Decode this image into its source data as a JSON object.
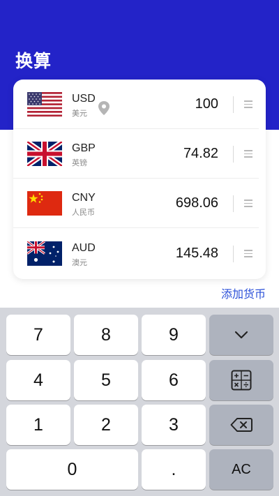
{
  "header": {
    "title": "换算"
  },
  "currencies": [
    {
      "code": "USD",
      "name": "美元",
      "amount": "100",
      "flag_icon": "us-flag-icon",
      "location_icon": "location-pin-icon"
    },
    {
      "code": "GBP",
      "name": "英镑",
      "amount": "74.82",
      "flag_icon": "uk-flag-icon"
    },
    {
      "code": "CNY",
      "name": "人民币",
      "amount": "698.06",
      "flag_icon": "china-flag-icon"
    },
    {
      "code": "AUD",
      "name": "澳元",
      "amount": "145.48",
      "flag_icon": "australia-flag-icon"
    }
  ],
  "add_currency_label": "添加货币",
  "keypad": {
    "k7": "7",
    "k8": "8",
    "k9": "9",
    "k4": "4",
    "k5": "5",
    "k6": "6",
    "k1": "1",
    "k2": "2",
    "k3": "3",
    "k0": "0",
    "dot": ".",
    "ac": "AC",
    "collapse_icon": "chevron-down-icon",
    "calculator_icon": "calculator-icon",
    "backspace_icon": "backspace-icon"
  },
  "colors": {
    "header": "#2323c8",
    "accent": "#2a4fd8",
    "keypad_bg": "#d4d6dc",
    "function_key": "#aeb3be"
  }
}
